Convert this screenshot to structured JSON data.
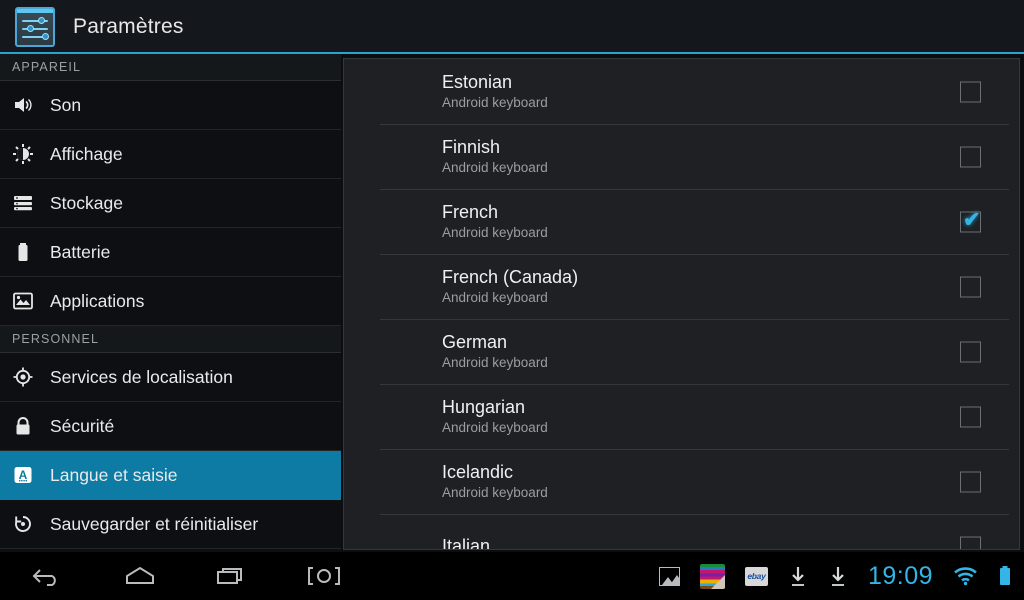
{
  "header": {
    "title": "Paramètres",
    "icon": "settings-sliders-icon"
  },
  "sidebar": {
    "groups": [
      {
        "label": "APPAREIL",
        "items": [
          {
            "label": "Son",
            "icon": "volume-icon",
            "selected": false
          },
          {
            "label": "Affichage",
            "icon": "brightness-icon",
            "selected": false
          },
          {
            "label": "Stockage",
            "icon": "storage-icon",
            "selected": false
          },
          {
            "label": "Batterie",
            "icon": "battery-icon",
            "selected": false
          },
          {
            "label": "Applications",
            "icon": "apps-image-icon",
            "selected": false
          }
        ]
      },
      {
        "label": "PERSONNEL",
        "items": [
          {
            "label": "Services de localisation",
            "icon": "location-target-icon",
            "selected": false
          },
          {
            "label": "Sécurité",
            "icon": "lock-icon",
            "selected": false
          },
          {
            "label": "Langue et saisie",
            "icon": "language-a-icon",
            "selected": true
          },
          {
            "label": "Sauvegarder et réinitialiser",
            "icon": "backup-restore-icon",
            "selected": false
          }
        ]
      }
    ],
    "selected_color": "#0d7ba4"
  },
  "content": {
    "subtitle_common": "Android keyboard",
    "rows": [
      {
        "title": "Estonian",
        "subtitle": "Android keyboard",
        "checked": false
      },
      {
        "title": "Finnish",
        "subtitle": "Android keyboard",
        "checked": false
      },
      {
        "title": "French",
        "subtitle": "Android keyboard",
        "checked": true
      },
      {
        "title": "French (Canada)",
        "subtitle": "Android keyboard",
        "checked": false
      },
      {
        "title": "German",
        "subtitle": "Android keyboard",
        "checked": false
      },
      {
        "title": "Hungarian",
        "subtitle": "Android keyboard",
        "checked": false
      },
      {
        "title": "Icelandic",
        "subtitle": "Android keyboard",
        "checked": false
      },
      {
        "title": "Italian",
        "subtitle": "",
        "checked": false
      }
    ],
    "checkbox_checked_color": "#33b5e5",
    "check_glyph": "✔"
  },
  "systembar": {
    "nav": [
      {
        "name": "back-icon",
        "label": "Back"
      },
      {
        "name": "home-icon",
        "label": "Home"
      },
      {
        "name": "recents-icon",
        "label": "Recent apps"
      },
      {
        "name": "screenshot-icon",
        "label": "Screenshot"
      }
    ],
    "status_icons": [
      {
        "name": "gallery-picture-icon"
      },
      {
        "name": "play-books-icon"
      },
      {
        "name": "ebay-icon",
        "label": "ebay"
      },
      {
        "name": "download-icon"
      },
      {
        "name": "download-icon"
      }
    ],
    "clock": "19:09",
    "wifi": "wifi-icon",
    "battery": "battery-full-icon",
    "accent_color": "#33b5e5"
  }
}
